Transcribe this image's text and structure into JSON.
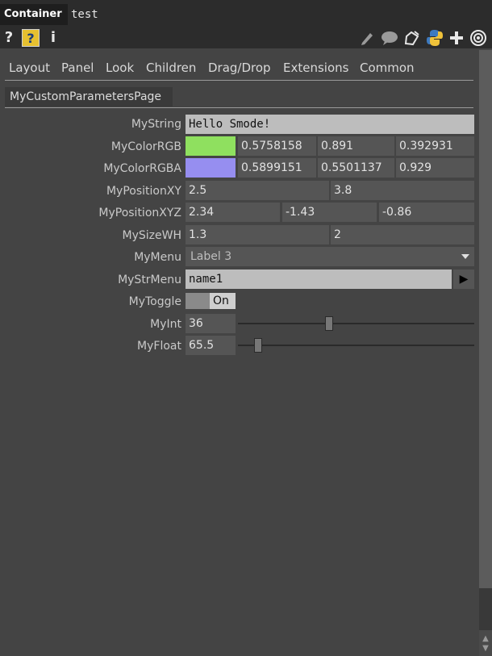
{
  "header": {
    "op_type": "Container",
    "op_name": "test"
  },
  "toolbar": {
    "help_glyph": "?",
    "python_help_glyph": "?",
    "info_glyph": "i",
    "icons": [
      "help-icon",
      "python-help-icon",
      "info-icon",
      "edit-icon",
      "comment-icon",
      "clone-icon",
      "python-icon",
      "add-icon",
      "target-icon"
    ]
  },
  "tabs": [
    "Layout",
    "Panel",
    "Look",
    "Children",
    "Drag/Drop",
    "Extensions",
    "Common"
  ],
  "page": {
    "name": "MyCustomParametersPage"
  },
  "params": {
    "mystring": {
      "label": "MyString",
      "value": "Hello Smode!"
    },
    "mycolorrgb": {
      "label": "MyColorRGB",
      "color": "#8fe05f",
      "r": "0.5758158",
      "g": "0.891",
      "b": "0.392931"
    },
    "mycolorrgba": {
      "label": "MyColorRGBA",
      "color": "#968ef0",
      "r": "0.5899151",
      "g": "0.5501137",
      "b": "0.929"
    },
    "mypositionxy": {
      "label": "MyPositionXY",
      "x": "2.5",
      "y": "3.8"
    },
    "mypositionxyz": {
      "label": "MyPositionXYZ",
      "x": "2.34",
      "y": "-1.43",
      "z": "-0.86"
    },
    "mysizewh": {
      "label": "MySizeWH",
      "w": "1.3",
      "h": "2"
    },
    "mymenu": {
      "label": "MyMenu",
      "value": "Label 3"
    },
    "mystrmenu": {
      "label": "MyStrMenu",
      "value": "name1",
      "button_glyph": "▶"
    },
    "mytoggle": {
      "label": "MyToggle",
      "state": "On"
    },
    "myint": {
      "label": "MyInt",
      "value": "36",
      "slider_fraction": 0.38
    },
    "myfloat": {
      "label": "MyFloat",
      "value": "65.5",
      "slider_fraction": 0.07
    }
  },
  "scrollbar": {
    "up_glyph": "▲",
    "down_glyph": "▼"
  }
}
